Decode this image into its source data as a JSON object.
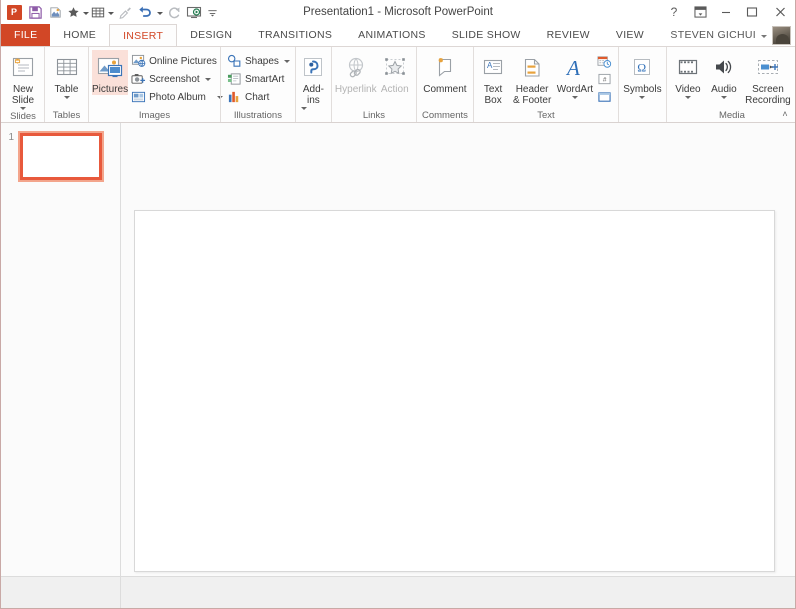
{
  "window": {
    "title": "Presentation1 - Microsoft PowerPoint",
    "app_initials": "P",
    "help_icon": "?",
    "ribbon_display_icon": "ribbon-display-options-icon",
    "minimize_icon": "–",
    "restore_icon": "❐",
    "close_icon": "✕"
  },
  "quick_access": {
    "items": [
      {
        "name": "save",
        "icon": "save-icon",
        "label": "Save",
        "enabled": true,
        "has_dropdown": false
      },
      {
        "name": "theme",
        "icon": "theme-icon",
        "label": "Theme",
        "enabled": true,
        "has_dropdown": false
      },
      {
        "name": "favorite",
        "icon": "star-icon",
        "label": "Favorite",
        "enabled": true,
        "has_dropdown": true
      },
      {
        "name": "table",
        "icon": "table-icon",
        "label": "Table",
        "enabled": true,
        "has_dropdown": true
      },
      {
        "name": "format-painter",
        "icon": "format-painter-icon",
        "label": "Format Painter",
        "enabled": false,
        "has_dropdown": false
      },
      {
        "name": "undo",
        "icon": "undo-icon",
        "label": "Undo",
        "enabled": true,
        "has_dropdown": true
      },
      {
        "name": "redo",
        "icon": "redo-icon",
        "label": "Redo",
        "enabled": false,
        "has_dropdown": false
      },
      {
        "name": "start-slideshow",
        "icon": "slideshow-icon",
        "label": "Start From Beginning",
        "enabled": true,
        "has_dropdown": false
      },
      {
        "name": "customize-qat",
        "icon": "chevron-down-icon",
        "label": "Customize Quick Access Toolbar",
        "enabled": true,
        "has_dropdown": false
      }
    ]
  },
  "tabs": {
    "file_label": "FILE",
    "items": [
      {
        "label": "HOME",
        "active": false
      },
      {
        "label": "INSERT",
        "active": true
      },
      {
        "label": "DESIGN",
        "active": false
      },
      {
        "label": "TRANSITIONS",
        "active": false
      },
      {
        "label": "ANIMATIONS",
        "active": false
      },
      {
        "label": "SLIDE SHOW",
        "active": false
      },
      {
        "label": "REVIEW",
        "active": false
      },
      {
        "label": "VIEW",
        "active": false
      }
    ]
  },
  "account": {
    "user_name": "STEVEN GICHUI"
  },
  "ribbon": {
    "collapse_label": "˄",
    "groups": [
      {
        "name": "slides",
        "label": "Slides",
        "big_buttons": [
          {
            "name": "new-slide",
            "icon": "new-slide-icon",
            "line1": "New",
            "line2": "Slide",
            "dropdown": true,
            "enabled": true
          }
        ]
      },
      {
        "name": "tables",
        "label": "Tables",
        "big_buttons": [
          {
            "name": "table",
            "icon": "table-grid-icon",
            "line1": "Table",
            "line2": "",
            "dropdown": true,
            "enabled": true
          }
        ]
      },
      {
        "name": "images",
        "label": "Images",
        "big_buttons": [
          {
            "name": "pictures",
            "icon": "pictures-icon",
            "line1": "Pictures",
            "line2": "",
            "dropdown": false,
            "enabled": true,
            "highlighted": true
          }
        ],
        "small_buttons": [
          {
            "name": "online-pictures",
            "icon": "online-pictures-icon",
            "label": "Online Pictures",
            "dropdown": false
          },
          {
            "name": "screenshot",
            "icon": "screenshot-icon",
            "label": "Screenshot",
            "dropdown": true
          },
          {
            "name": "photo-album",
            "icon": "photo-album-icon",
            "label": "Photo Album",
            "dropdown": true
          }
        ]
      },
      {
        "name": "illustrations",
        "label": "Illustrations",
        "small_buttons": [
          {
            "name": "shapes",
            "icon": "shapes-icon",
            "label": "Shapes",
            "dropdown": true
          },
          {
            "name": "smartart",
            "icon": "smartart-icon",
            "label": "SmartArt",
            "dropdown": false
          },
          {
            "name": "chart",
            "icon": "chart-icon",
            "label": "Chart",
            "dropdown": false
          }
        ]
      },
      {
        "name": "add-ins",
        "label": "",
        "big_buttons": [
          {
            "name": "add-ins",
            "icon": "add-ins-icon",
            "line1": "Add-",
            "line2": "ins",
            "dropdown": true,
            "enabled": true
          }
        ]
      },
      {
        "name": "links",
        "label": "Links",
        "big_buttons": [
          {
            "name": "hyperlink",
            "icon": "hyperlink-icon",
            "line1": "Hyperlink",
            "line2": "",
            "dropdown": false,
            "enabled": false
          },
          {
            "name": "action",
            "icon": "action-icon",
            "line1": "Action",
            "line2": "",
            "dropdown": false,
            "enabled": false
          }
        ]
      },
      {
        "name": "comments",
        "label": "Comments",
        "big_buttons": [
          {
            "name": "comment",
            "icon": "comment-icon",
            "line1": "Comment",
            "line2": "",
            "dropdown": false,
            "enabled": true
          }
        ]
      },
      {
        "name": "text",
        "label": "Text",
        "big_buttons": [
          {
            "name": "text-box",
            "icon": "text-box-icon",
            "line1": "Text",
            "line2": "Box",
            "dropdown": false,
            "enabled": true
          },
          {
            "name": "header-footer",
            "icon": "header-footer-icon",
            "line1": "Header",
            "line2": "& Footer",
            "dropdown": false,
            "enabled": true
          },
          {
            "name": "wordart",
            "icon": "wordart-icon",
            "line1": "WordArt",
            "line2": "",
            "dropdown": true,
            "enabled": true
          }
        ],
        "tiny_buttons": [
          {
            "name": "date-and-time",
            "icon": "date-time-icon",
            "label": "Date & Time"
          },
          {
            "name": "slide-number",
            "icon": "slide-number-icon",
            "label": "Slide Number"
          },
          {
            "name": "object",
            "icon": "object-icon",
            "label": "Object"
          }
        ]
      },
      {
        "name": "symbols",
        "label": "",
        "big_buttons": [
          {
            "name": "symbols",
            "icon": "omega-icon",
            "line1": "Symbols",
            "line2": "",
            "dropdown": true,
            "enabled": true
          }
        ]
      },
      {
        "name": "media",
        "label": "Media",
        "big_buttons": [
          {
            "name": "video",
            "icon": "video-icon",
            "line1": "Video",
            "line2": "",
            "dropdown": true,
            "enabled": true
          },
          {
            "name": "audio",
            "icon": "audio-icon",
            "line1": "Audio",
            "line2": "",
            "dropdown": true,
            "enabled": true
          },
          {
            "name": "screen-recording",
            "icon": "screen-recording-icon",
            "line1": "Screen",
            "line2": "Recording",
            "dropdown": false,
            "enabled": true
          }
        ]
      }
    ]
  },
  "slides_panel": {
    "thumbnails": [
      {
        "number": "1",
        "selected": true
      }
    ]
  },
  "colors": {
    "accent": "#d24726",
    "tab_active_text": "#d24726",
    "highlight": "#fae0d9",
    "thumb_border": "#e8593c",
    "workspace": "#fbfbfb",
    "status_bar": "#f0f0f0"
  }
}
